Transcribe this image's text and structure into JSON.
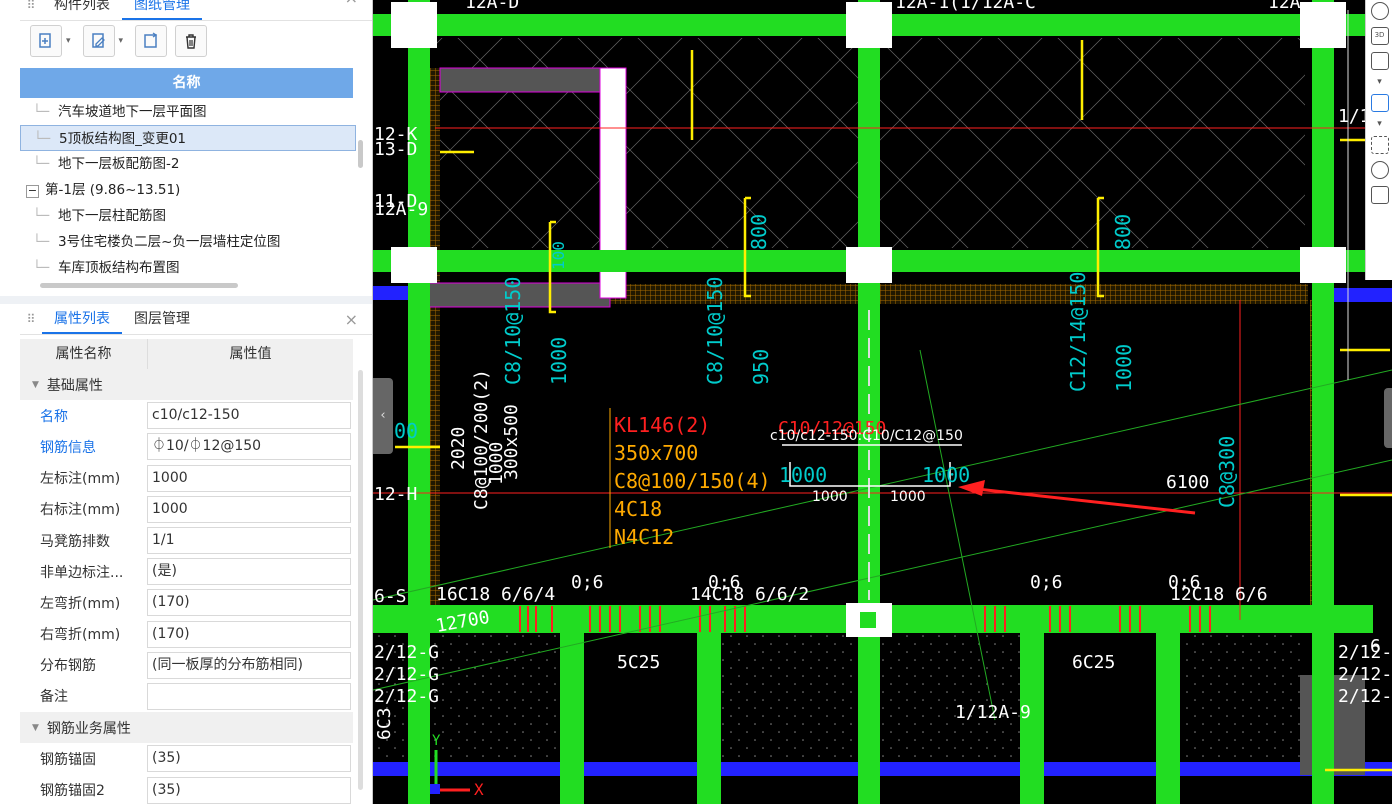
{
  "top_panel": {
    "tabs": [
      "构件列表",
      "图纸管理"
    ],
    "active_tab": 1,
    "close": "×",
    "toolbar": [
      {
        "icon": "add-drawing-icon",
        "dropdown": true
      },
      {
        "icon": "edit-drawing-icon",
        "dropdown": true
      },
      {
        "icon": "refresh-drawing-icon",
        "dropdown": false
      },
      {
        "icon": "delete-icon",
        "dropdown": false
      }
    ],
    "tree_header": "名称",
    "tree_items": [
      {
        "label": "汽车坡道地下一层平面图",
        "level": 1,
        "selected": false
      },
      {
        "label": "5顶板结构图_变更01",
        "level": 1,
        "selected": true
      },
      {
        "label": "地下一层板配筋图-2",
        "level": 1,
        "selected": false
      },
      {
        "label": "第-1层 (9.86~13.51)",
        "level": 0,
        "selected": false,
        "toggle": "−"
      },
      {
        "label": "地下一层柱配筋图",
        "level": 1,
        "selected": false
      },
      {
        "label": "3号住宅楼负二层~负一层墙柱定位图",
        "level": 1,
        "selected": false
      },
      {
        "label": "车库顶板结构布置图",
        "level": 1,
        "selected": false
      }
    ]
  },
  "bottom_panel": {
    "tabs": [
      "属性列表",
      "图层管理"
    ],
    "active_tab": 0,
    "close": "×",
    "col_name": "属性名称",
    "col_value": "属性值",
    "rows": [
      {
        "group": "基础属性"
      },
      {
        "name": "名称",
        "value": "c10/c12-150",
        "blue": true
      },
      {
        "name": "钢筋信息",
        "value": "⏀10/⏀12@150",
        "blue": true
      },
      {
        "name": "左标注(mm)",
        "value": "1000"
      },
      {
        "name": "右标注(mm)",
        "value": "1000"
      },
      {
        "name": "马凳筋排数",
        "value": "1/1"
      },
      {
        "name": "非单边标注...",
        "value": "(是)"
      },
      {
        "name": "左弯折(mm)",
        "value": "(170)"
      },
      {
        "name": "右弯折(mm)",
        "value": "(170)"
      },
      {
        "name": "分布钢筋",
        "value": "(同一板厚的分布筋相同)"
      },
      {
        "name": "备注",
        "value": ""
      },
      {
        "group": "钢筋业务属性"
      },
      {
        "name": "钢筋锚固",
        "value": "(35)"
      },
      {
        "name": "钢筋锚固2",
        "value": "(35)"
      }
    ]
  },
  "cad": {
    "labels": {
      "top1": "12A-D",
      "top2": "12A-1(1/12A-C",
      "top3": "12A",
      "k1": "12-K",
      "k2": "13-D",
      "d1": "11-D",
      "d2": "12A-9",
      "h": "12-H",
      "s": "6-S",
      "r1": "1/1",
      "v800a": "800",
      "v800b": "800",
      "v100": "100",
      "c8a": "C8/10@150",
      "c1000a": "1000",
      "c8b": "C8/10@150",
      "c950": "950",
      "c12": "C12/14@150",
      "c1000b": "1000",
      "beam": "C8@100/200(2)",
      "beam2": "300x500",
      "beam3": "2020",
      "beam4": "1000",
      "kl1": "KL146(2)",
      "kl2": "350x700",
      "kl3": "C8@100/150(4)",
      "kl4": "4C18",
      "kl5": "N4C12",
      "rebar_red": "C10/12@150",
      "rebar_white": "c10/c12-150:C10/C12@150",
      "dim_left": "1000",
      "dim_right": "1000",
      "dim_l2": "1000",
      "dim_r2": "1000",
      "dim6100": "6100",
      "c8r": "C8@300",
      "b1": "16C18 6/6/4",
      "b2": "0;6",
      "b3": "14C18 6/6/2",
      "b4": "0;6",
      "b5": "0;6",
      "b6": "0;6",
      "b7": "12C18 6/6",
      "b8": "12700",
      "g1": "2/12-G",
      "g2": "2/12-G",
      "g3": "2/12-G",
      "c25a": "5C25",
      "c25b": "6C25",
      "a9": "1/12A-9",
      "r2": "2/12-",
      "r3": "2/12-",
      "r4": "2/12-",
      "r5": "6",
      "lc": "6C3",
      "axis_y": "Y",
      "axis_x": "X",
      "left00": "00"
    }
  }
}
